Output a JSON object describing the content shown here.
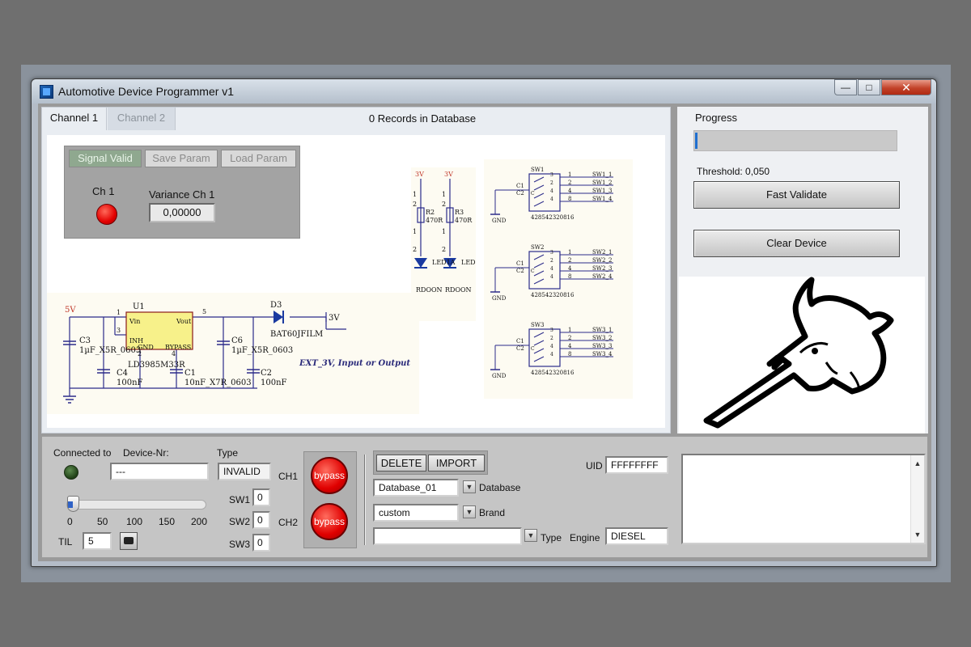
{
  "window": {
    "title": "Automotive Device Programmer v1"
  },
  "tabs": [
    {
      "label": "Channel 1",
      "active": true
    },
    {
      "label": "Channel 2",
      "active": false
    }
  ],
  "records_status": "0 Records in Database",
  "signal_panel": {
    "buttons": [
      {
        "label": "Signal Valid",
        "enabled": true
      },
      {
        "label": "Save Param",
        "enabled": false
      },
      {
        "label": "Load Param",
        "enabled": false
      }
    ],
    "ch1_label": "Ch 1",
    "ch1_led_color": "#e30000",
    "variance_label": "Variance Ch 1",
    "variance_value": "0,00000"
  },
  "schematic": {
    "power": {
      "labels": [
        "5V",
        "U1",
        "Vin",
        "Vout",
        "INH",
        "GND",
        "BYPASS",
        "LD3985M33R",
        "D3",
        "BAT60JFILM",
        "3V",
        "EXT_3V, Input or Output"
      ],
      "pins": [
        "1",
        "3",
        "2",
        "4",
        "5"
      ],
      "caps": [
        "C3",
        "1µF_X5R_0603",
        "C4",
        "100nF",
        "C1",
        "10nF_X7R_0603",
        "C6",
        "1µF_X5R_0603",
        "C2",
        "100nF"
      ]
    },
    "leds": {
      "labels": [
        "3V",
        "3V",
        "R2",
        "470R",
        "R3",
        "470R",
        "LED1A",
        "LED1B",
        "RDOON",
        "RDOON"
      ],
      "pins": [
        "1",
        "2",
        "1",
        "2",
        "1",
        "2",
        "1",
        "2"
      ]
    },
    "switches": [
      {
        "name": "SW1",
        "part": "428542320816",
        "lines": [
          "SW1_1",
          "SW1_2",
          "SW1_3",
          "SW1_4"
        ]
      },
      {
        "name": "SW2",
        "part": "428542320816",
        "lines": [
          "SW2_1",
          "SW2_2",
          "SW2_3",
          "SW2_4"
        ]
      },
      {
        "name": "SW3",
        "part": "428542320816",
        "lines": [
          "SW3_1",
          "SW3_2",
          "SW3_3",
          "SW3_4"
        ]
      }
    ],
    "switch_common": {
      "c1": "C1",
      "c2": "C2",
      "c": "C",
      "gnd": "GND",
      "pins": [
        "1",
        "2",
        "4",
        "8"
      ],
      "inner_pins": [
        "3",
        "2",
        "4",
        "4"
      ]
    }
  },
  "right_panel": {
    "progress_label": "Progress",
    "progress_value": 0.01,
    "progress_color": "#1f6fd0",
    "threshold_label": "Threshold: 0,050",
    "fast_validate_label": "Fast Validate",
    "clear_device_label": "Clear Device",
    "logo": "narwhal-logo"
  },
  "connection": {
    "connected_label": "Connected to",
    "device_nr_label": "Device-Nr:",
    "device_nr_value": "---",
    "type_label": "Type",
    "type_value": "INVALID",
    "led_color": "#2f5a24",
    "slider_value": 0,
    "slider_ticks": [
      "0",
      "50",
      "100",
      "150",
      "200"
    ],
    "til_label": "TIL",
    "til_value": "5"
  },
  "switch_fields": [
    {
      "label": "SW1",
      "value": "0"
    },
    {
      "label": "SW2",
      "value": "0"
    },
    {
      "label": "SW3",
      "value": "0"
    }
  ],
  "bypass": {
    "ch1_label": "CH1",
    "ch2_label": "CH2",
    "button_label": "bypass"
  },
  "database": {
    "delete_label": "DELETE",
    "import_label": "IMPORT",
    "database_value": "Database_01",
    "database_label": "Database",
    "brand_value": "custom",
    "brand_label": "Brand",
    "type_value": "",
    "type_label": "Type",
    "engine_label": "Engine",
    "engine_value": "DIESEL",
    "uid_label": "UID",
    "uid_value": "FFFFFFFF"
  },
  "log": {
    "text": ""
  }
}
